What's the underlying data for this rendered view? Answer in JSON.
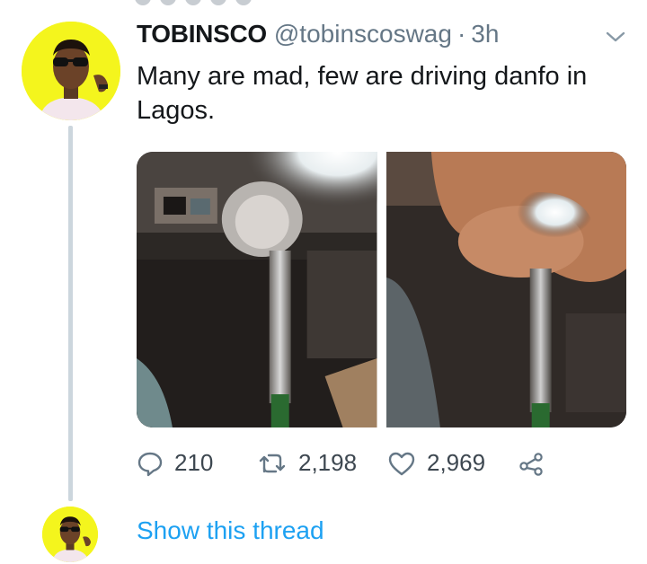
{
  "tweet": {
    "display_name": "TOBINSCO",
    "handle": "@tobinscoswag",
    "separator": "·",
    "time": "3h",
    "text": "Many are mad, few are driving danfo in Lagos.",
    "media": [
      {
        "icon": "photo-gear-shift-showerhead"
      },
      {
        "icon": "photo-hand-on-showerhead"
      }
    ],
    "actions": {
      "reply_count": "210",
      "retweet_count": "2,198",
      "like_count": "2,969"
    }
  },
  "thread": {
    "show_label": "Show this thread"
  },
  "colors": {
    "link": "#1da1f2",
    "muted": "#657786",
    "avatar_bg": "#f4f51d",
    "thread_line": "#ccd6dd"
  },
  "icons": [
    "chevron-down-icon",
    "reply-icon",
    "retweet-icon",
    "heart-icon",
    "share-icon"
  ]
}
